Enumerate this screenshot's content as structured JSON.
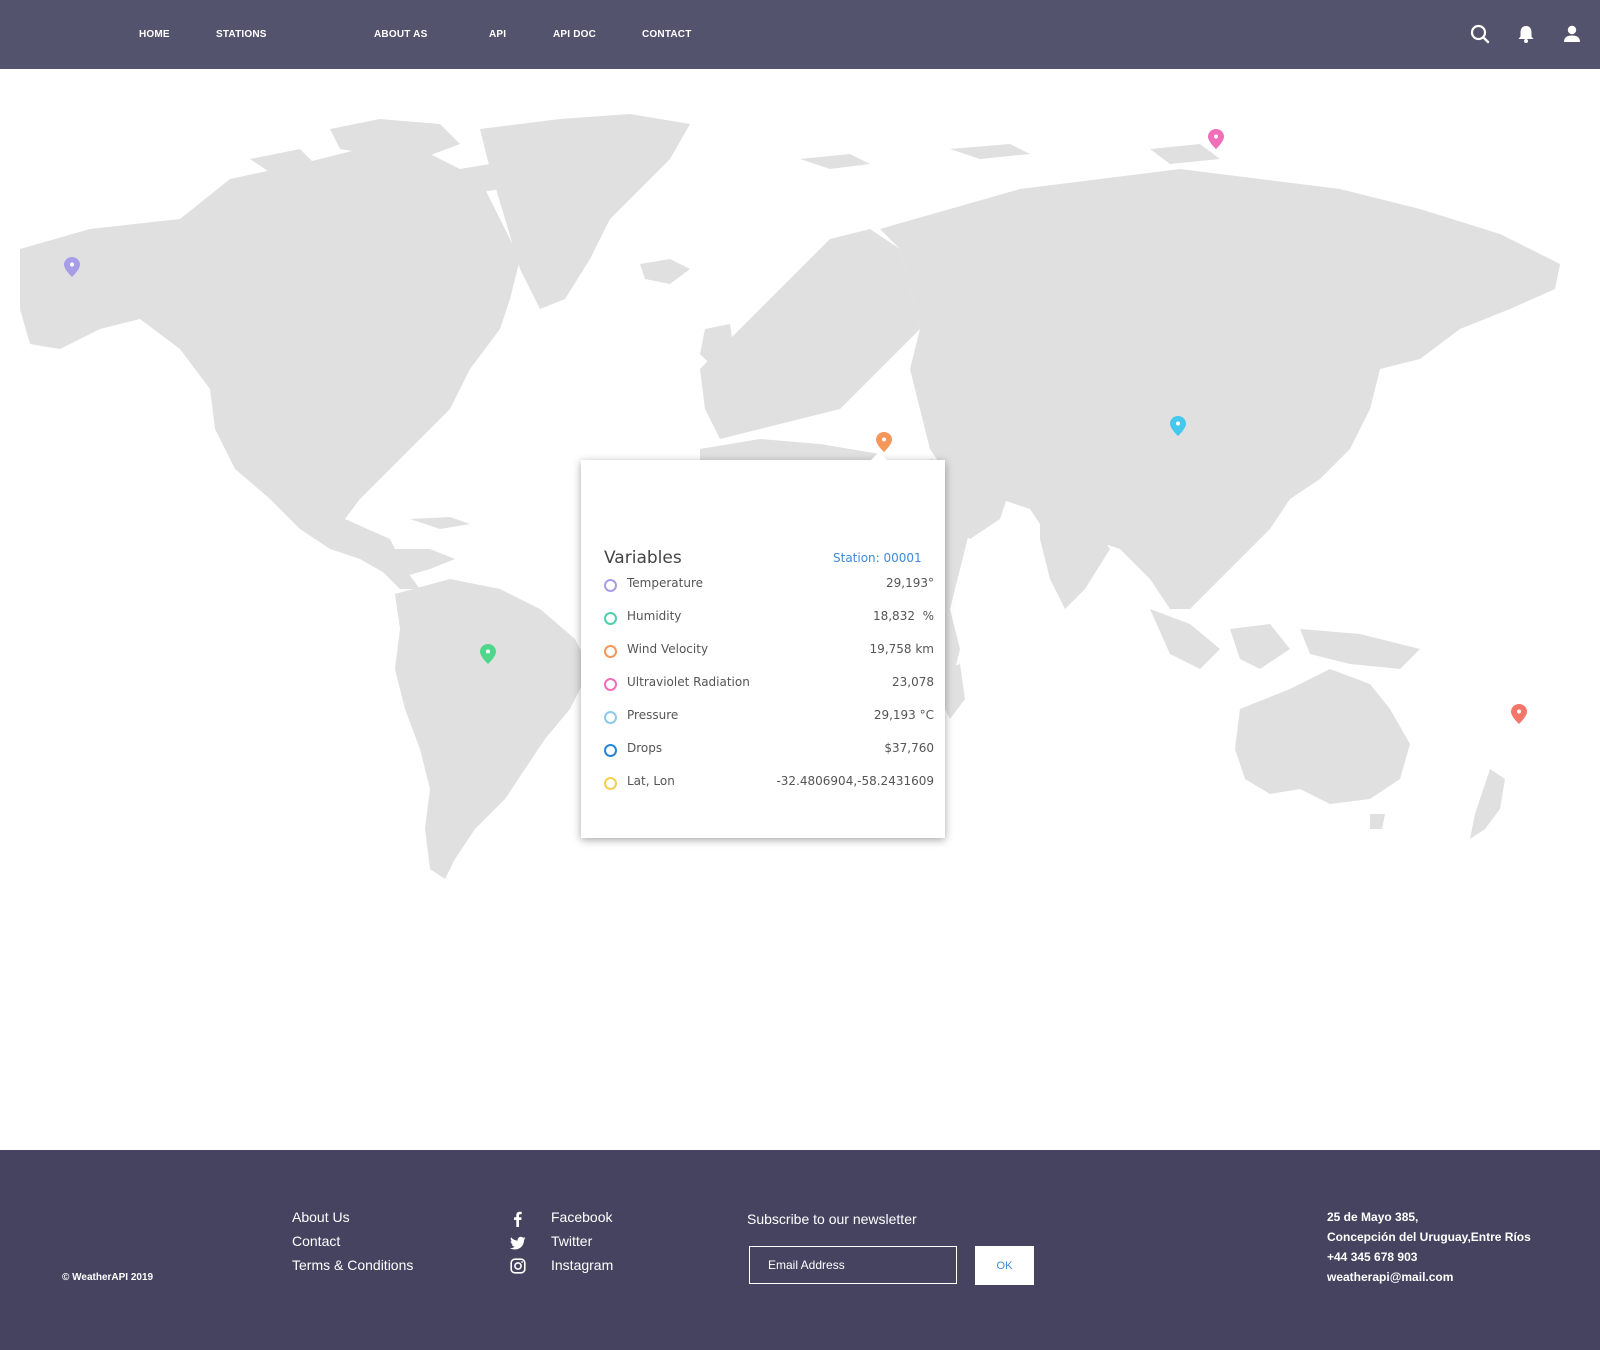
{
  "nav": {
    "items": [
      "HOME",
      "STATIONS",
      "ABOUT AS",
      "API",
      "API DOC",
      "CONTACT"
    ],
    "icons": [
      "search-icon",
      "bell-icon",
      "user-icon"
    ]
  },
  "map": {
    "land_color": "#e0e0e0",
    "markers": [
      {
        "color": "#a89ee8"
      },
      {
        "color": "#f06fb8"
      },
      {
        "color": "#f4975b"
      },
      {
        "color": "#44c8ee"
      },
      {
        "color": "#4fd68a"
      },
      {
        "color": "#f2776b"
      }
    ]
  },
  "popup": {
    "title": "Variables",
    "station": "Station: 00001",
    "variables": [
      {
        "label": "Temperature",
        "value": "29,193°",
        "color": "#a89ee8"
      },
      {
        "label": "Humidity",
        "value": "18,832  %",
        "color": "#4fcfae"
      },
      {
        "label": "Wind Velocity",
        "value": "19,758 km",
        "color": "#f4975b"
      },
      {
        "label": "Ultraviolet Radiation",
        "value": "23,078",
        "color": "#f06fb8"
      },
      {
        "label": "Pressure",
        "value": "29,193 °C",
        "color": "#8cc9ef"
      },
      {
        "label": "Drops",
        "value": "$37,760",
        "color": "#2586d9"
      },
      {
        "label": "Lat, Lon",
        "value": "-32.4806904,-58.2431609",
        "color": "#f5cf55"
      }
    ]
  },
  "footer": {
    "copyright": "© WeatherAPI 2019",
    "links": [
      "About Us",
      "Contact",
      "Terms & Conditions"
    ],
    "social": [
      {
        "label": "Facebook",
        "icon": "facebook-icon"
      },
      {
        "label": "Twitter",
        "icon": "twitter-icon"
      },
      {
        "label": "Instagram",
        "icon": "instagram-icon"
      }
    ],
    "newsletter": {
      "title": "Subscribe to our newsletter",
      "placeholder": "Email Address",
      "button": "OK"
    },
    "address": [
      "25 de Mayo 385,",
      "Concepción del Uruguay,Entre Ríos",
      "+44 345 678 903",
      "weatherapi@mail.com"
    ]
  },
  "colors": {
    "header_bg": "#54536e",
    "footer_bg": "#45435f",
    "accent": "#3d8bdc"
  }
}
